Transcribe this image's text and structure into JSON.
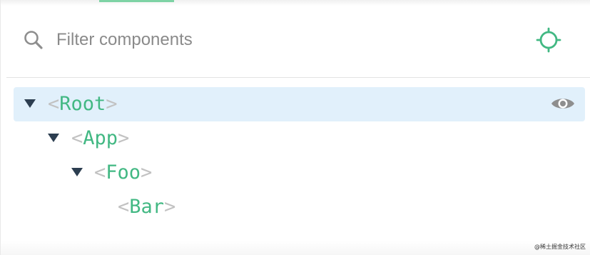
{
  "filter": {
    "placeholder": "Filter components",
    "value": ""
  },
  "colors": {
    "accent": "#42b883",
    "selected_row": "#e1f0fb",
    "bracket": "#c2c2c2",
    "arrow": "#2c3e50"
  },
  "icons": {
    "search": "search-icon",
    "locate": "crosshair-icon",
    "visibility": "eye-icon",
    "expand": "caret-down-icon"
  },
  "tree": {
    "open_bracket": "<",
    "close_bracket": ">",
    "nodes": [
      {
        "name": "Root",
        "depth": 0,
        "expanded": true,
        "selected": true
      },
      {
        "name": "App",
        "depth": 1,
        "expanded": true,
        "selected": false
      },
      {
        "name": "Foo",
        "depth": 2,
        "expanded": true,
        "selected": false
      },
      {
        "name": "Bar",
        "depth": 3,
        "expanded": false,
        "selected": false
      }
    ]
  },
  "watermark": "@稀土掘金技术社区"
}
